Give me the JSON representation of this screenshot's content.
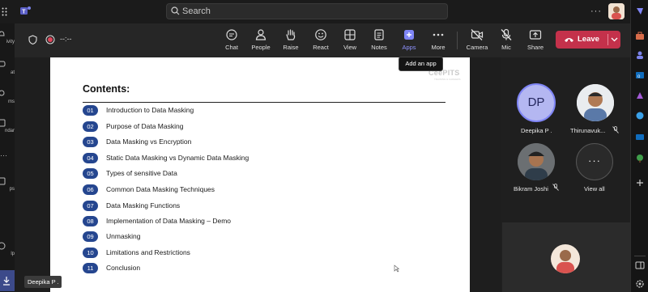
{
  "search": {
    "placeholder": "Search"
  },
  "meeting": {
    "timer": "--:--"
  },
  "left_rail": [
    {
      "label": "ivity"
    },
    {
      "label": "at"
    },
    {
      "label": "ms"
    },
    {
      "label": "ndar"
    },
    {
      "label": "ps"
    },
    {
      "label": "lp"
    }
  ],
  "toolbar": [
    {
      "label": "Chat",
      "icon": "chat-icon"
    },
    {
      "label": "People",
      "icon": "people-icon"
    },
    {
      "label": "Raise",
      "icon": "raise-hand-icon"
    },
    {
      "label": "React",
      "icon": "react-icon"
    },
    {
      "label": "View",
      "icon": "view-icon"
    },
    {
      "label": "Notes",
      "icon": "notes-icon"
    },
    {
      "label": "Apps",
      "icon": "apps-icon",
      "active": true
    },
    {
      "label": "More",
      "icon": "more-icon"
    },
    {
      "label": "Camera",
      "icon": "camera-off-icon"
    },
    {
      "label": "Mic",
      "icon": "mic-off-icon"
    },
    {
      "label": "Share",
      "icon": "share-icon"
    }
  ],
  "leave": {
    "label": "Leave"
  },
  "tooltip": "Add an app",
  "slide": {
    "title": "Contents:",
    "logo": "CeePITS",
    "logo_sub": "TRAINING & CAREERS",
    "items": [
      {
        "num": "01",
        "text": "Introduction to Data Masking"
      },
      {
        "num": "02",
        "text": "Purpose of Data Masking"
      },
      {
        "num": "03",
        "text": "Data Masking vs Encryption"
      },
      {
        "num": "04",
        "text": "Static Data Masking vs Dynamic Data Masking"
      },
      {
        "num": "05",
        "text": "Types of sensitive Data"
      },
      {
        "num": "06",
        "text": "Common Data Masking Techniques"
      },
      {
        "num": "07",
        "text": "Data Masking Functions"
      },
      {
        "num": "08",
        "text": "Implementation of Data Masking – Demo"
      },
      {
        "num": "09",
        "text": "Unmasking"
      },
      {
        "num": "10",
        "text": "Limitations and Restrictions"
      },
      {
        "num": "11",
        "text": "Conclusion"
      }
    ]
  },
  "participants": [
    {
      "name": "Deepika P .",
      "initials": "DP"
    },
    {
      "name": "Thirunavuk...",
      "muted": true
    },
    {
      "name": "Bikram Joshi",
      "muted": true
    },
    {
      "name": "View all"
    }
  ],
  "presenter_tag": "Deepika P .",
  "colors": {
    "accent": "#7f85f5",
    "leave": "#c4314b",
    "toc_badge": "#25468f"
  }
}
